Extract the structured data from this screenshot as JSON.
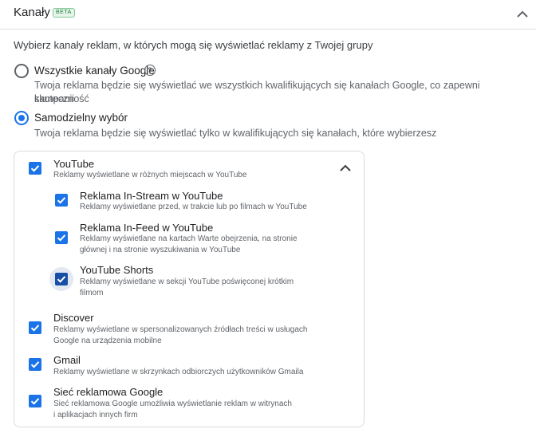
{
  "header": {
    "title": "Kanały",
    "badge": "BETA"
  },
  "intro": "Wybierz kanały reklam, w których mogą się wyświetlać reklamy z Twojej grupy",
  "options": [
    {
      "label": "Wszystkie kanały Google",
      "desc1": "Twoja reklama będzie się wyświetlać we wszystkich kwalifikujących się kanałach Google, co zapewni skuteczność",
      "desc2": "kampanii",
      "selected": false
    },
    {
      "label": "Samodzielny wybór",
      "desc1": "Twoja reklama będzie się wyświetlać tylko w kwalifikujących się kanałach, które wybierzesz",
      "selected": true
    }
  ],
  "help_icon": "help-circle-icon",
  "channels": {
    "youtube": {
      "label": "YouTube",
      "desc": "Reklamy wyświetlane w różnych miejscach w YouTube",
      "checked": true,
      "sub": [
        {
          "label": "Reklama In-Stream w YouTube",
          "desc1": "Reklamy wyświetlane przed, w trakcie lub po filmach w YouTube",
          "checked": true
        },
        {
          "label": "Reklama In-Feed w YouTube",
          "desc1": "Reklamy wyświetlane na kartach Warte obejrzenia, na stronie",
          "desc2": "głównej i na stronie wyszukiwania w YouTube",
          "checked": true
        },
        {
          "label": "YouTube Shorts",
          "desc1": "Reklamy wyświetlane w sekcji YouTube poświęconej krótkim",
          "desc2": "filmom",
          "checked": true
        }
      ]
    },
    "discover": {
      "label": "Discover",
      "desc1": "Reklamy wyświetlane w spersonalizowanych źródłach treści w usługach",
      "desc2": "Google na urządzenia mobilne",
      "checked": true
    },
    "gmail": {
      "label": "Gmail",
      "desc1": "Reklamy wyświetlane w skrzynkach odbiorczych użytkowników Gmaila",
      "checked": true
    },
    "display": {
      "label": "Sieć reklamowa Google",
      "desc1": "Sieć reklamowa Google umożliwia wyświetlanie reklam w witrynach",
      "desc2": "i aplikacjach innych firm",
      "checked": true
    }
  },
  "colors": {
    "accent": "#1a73e8",
    "beta_green": "#188038"
  }
}
